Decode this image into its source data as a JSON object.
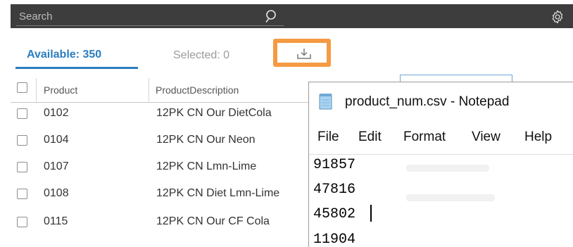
{
  "search": {
    "placeholder": "Search"
  },
  "tabs": {
    "available_label": "Available: 350",
    "selected_label": "Selected: 0"
  },
  "table": {
    "columns": [
      "Product",
      "ProductDescription"
    ],
    "rows": [
      {
        "product": "0102",
        "description": "12PK CN Our DietCola"
      },
      {
        "product": "0104",
        "description": "12PK CN Our Neon"
      },
      {
        "product": "0107",
        "description": "12PK CN Lmn-Lime"
      },
      {
        "product": "0108",
        "description": "12PK CN Diet Lmn-Lime"
      },
      {
        "product": "0115",
        "description": "12PK CN Our CF Cola"
      }
    ]
  },
  "notepad": {
    "title": "product_num.csv - Notepad",
    "menu": [
      "File",
      "Edit",
      "Format",
      "View",
      "Help"
    ],
    "lines": [
      "91857",
      "47816",
      "45802",
      "11904"
    ]
  },
  "colors": {
    "topbar": "#3d3d3d",
    "accent": "#2a7dc0",
    "highlight": "#f59a42"
  },
  "icons": {
    "search": "search-icon",
    "settings": "gear-icon",
    "download": "download-icon",
    "notepad": "notepad-icon"
  }
}
